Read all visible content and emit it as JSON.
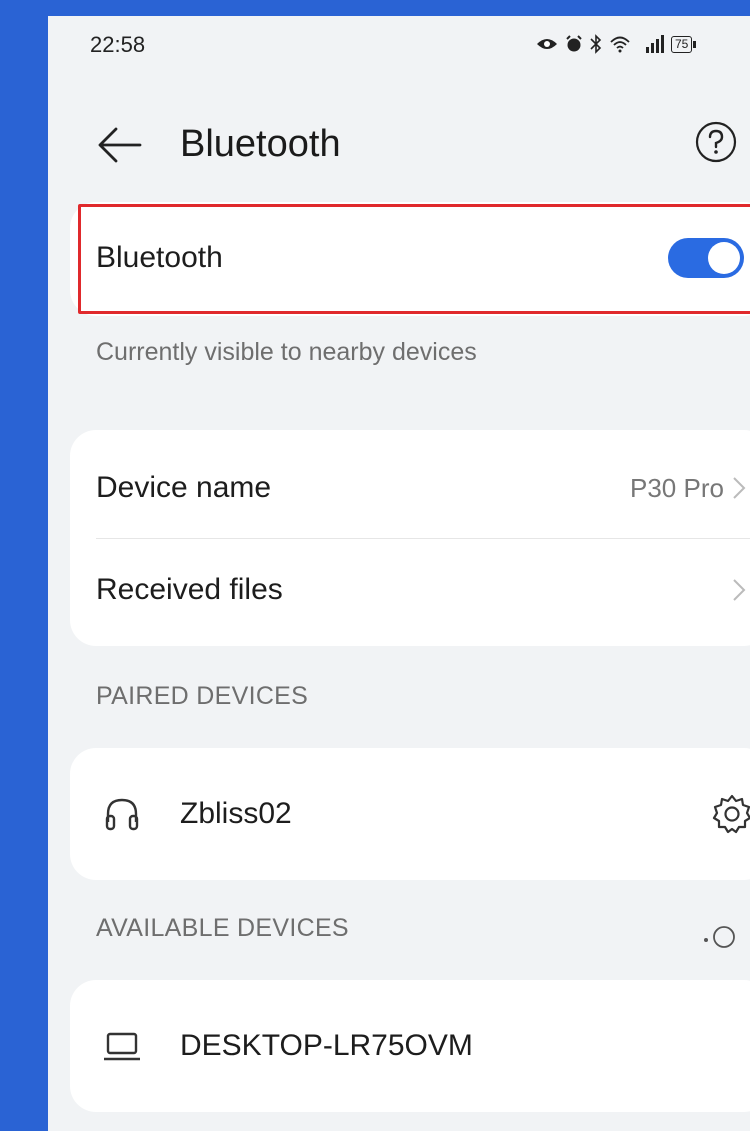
{
  "status_bar": {
    "time": "22:58",
    "battery": "75"
  },
  "header": {
    "title": "Bluetooth"
  },
  "bluetooth_toggle": {
    "label": "Bluetooth",
    "state": "on",
    "accent": "#2a6be2"
  },
  "visibility": {
    "text": "Currently visible to nearby devices"
  },
  "settings": {
    "device_name_label": "Device name",
    "device_name_value": "P30 Pro",
    "received_files_label": "Received files"
  },
  "paired": {
    "header": "PAIRED DEVICES",
    "devices": [
      {
        "name": "Zbliss02",
        "icon": "headphones-icon"
      }
    ]
  },
  "available": {
    "header": "AVAILABLE DEVICES",
    "devices": [
      {
        "name": "DESKTOP-LR75OVM",
        "icon": "laptop-icon"
      }
    ]
  },
  "colors": {
    "background": "#2a63d4",
    "highlight_border": "#e0292c"
  }
}
